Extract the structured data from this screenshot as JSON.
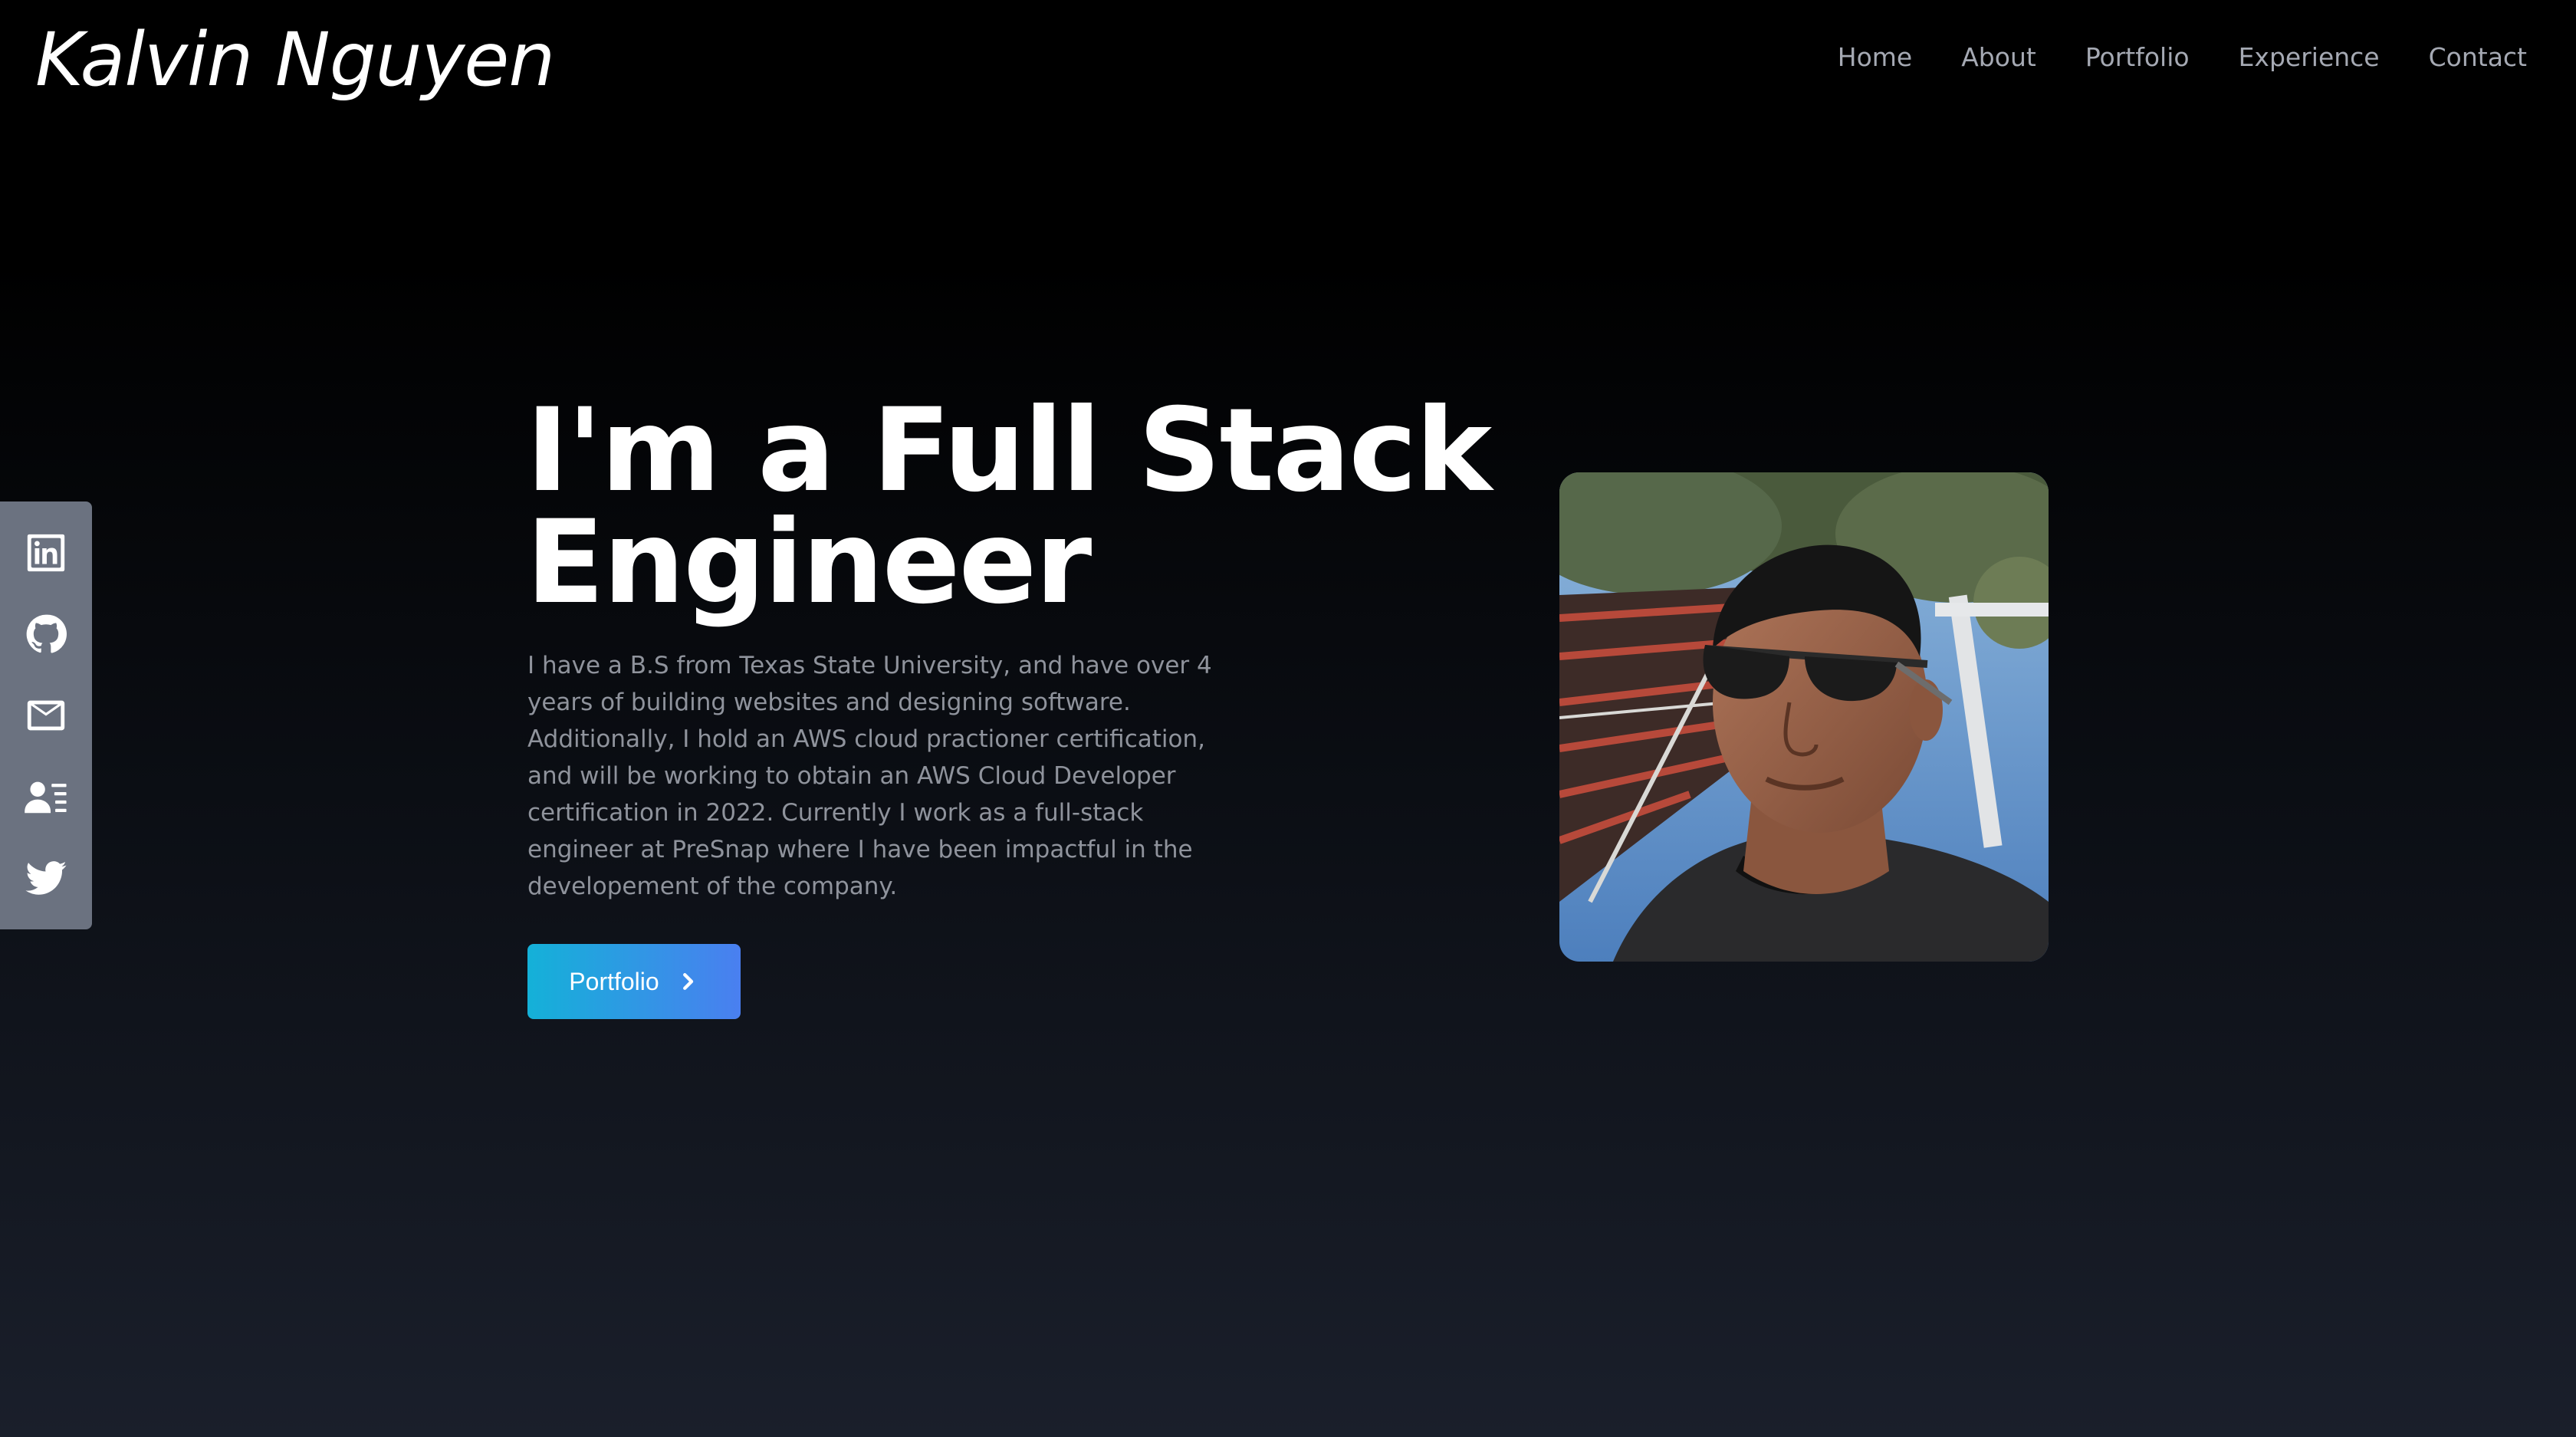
{
  "navbar": {
    "brand": "Kalvin Nguyen",
    "links": [
      "Home",
      "About",
      "Portfolio",
      "Experience",
      "Contact"
    ]
  },
  "social": {
    "icons": [
      "linkedin-icon",
      "github-icon",
      "mail-icon",
      "resume-icon",
      "twitter-icon"
    ],
    "background": "#6b7280"
  },
  "hero": {
    "title_line1": "I'm a Full Stack",
    "title_line2": "Engineer",
    "description": "I have a B.S from Texas State University, and have over 4 years of building websites and designing software. Additionally, I hold an AWS cloud practioner certification, and will be working to obtain an AWS Cloud Developer certification in 2022. Currently I work as a full-stack engineer at PreSnap where I have been impactful in the developement of the company.",
    "button_label": "Portfolio",
    "button_gradient": [
      "#14b1d8",
      "#4a7ff0"
    ]
  }
}
